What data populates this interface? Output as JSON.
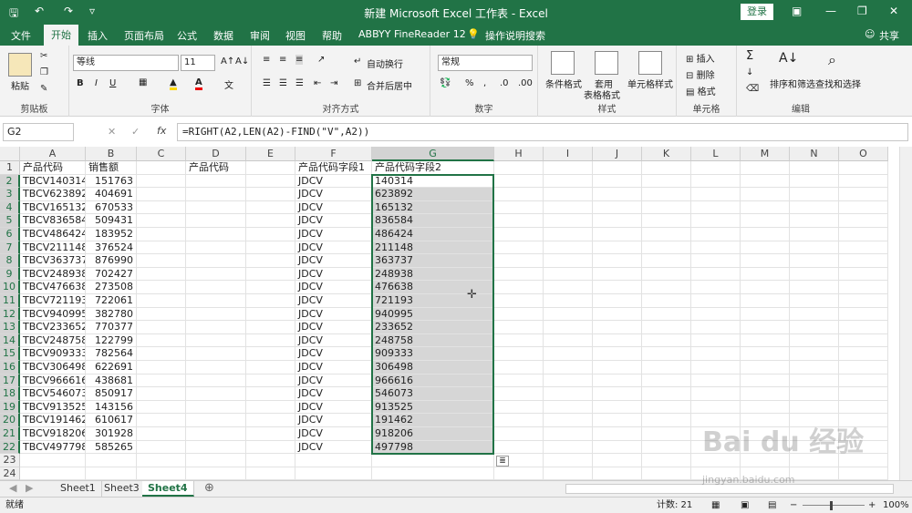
{
  "titlebar": {
    "title": "新建 Microsoft Excel 工作表 - Excel",
    "login": "登录"
  },
  "tabs": [
    "文件",
    "开始",
    "插入",
    "页面布局",
    "公式",
    "数据",
    "审阅",
    "视图",
    "帮助",
    "ABBYY FineReader 12",
    "操作说明搜索"
  ],
  "share": "共享",
  "ribbon": {
    "clipboard": {
      "label": "剪贴板",
      "paste": "粘贴"
    },
    "font": {
      "label": "字体",
      "name": "等线",
      "size": "11",
      "bold": "B",
      "italic": "I",
      "underline": "U"
    },
    "align": {
      "label": "对齐方式",
      "wrap": "自动换行",
      "merge": "合并后居中"
    },
    "number": {
      "label": "数字",
      "format": "常规"
    },
    "styles": {
      "label": "样式",
      "cond": "条件格式",
      "table1": "套用",
      "table2": "表格格式",
      "cell": "单元格样式"
    },
    "cells": {
      "label": "单元格",
      "insert": "插入",
      "delete": "删除",
      "format": "格式"
    },
    "editing": {
      "label": "编辑",
      "sort": "排序和筛选",
      "find": "查找和选择"
    }
  },
  "formula_bar": {
    "namebox": "G2",
    "fx": "fx",
    "formula": "=RIGHT(A2,LEN(A2)-FIND(\"V\",A2))"
  },
  "columns": [
    "A",
    "B",
    "C",
    "D",
    "E",
    "F",
    "G",
    "H",
    "I",
    "J",
    "K",
    "L",
    "M",
    "N",
    "O"
  ],
  "header_row": {
    "A": "产品代码",
    "B": "销售额",
    "D": "产品代码",
    "F": "产品代码字段1",
    "G": "产品代码字段2"
  },
  "rows": [
    {
      "A": "TBCV140314",
      "B": "151763",
      "F": "JDCV",
      "G": "140314"
    },
    {
      "A": "TBCV623892",
      "B": "404691",
      "F": "JDCV",
      "G": "623892"
    },
    {
      "A": "TBCV165132",
      "B": "670533",
      "F": "JDCV",
      "G": "165132"
    },
    {
      "A": "TBCV836584",
      "B": "509431",
      "F": "JDCV",
      "G": "836584"
    },
    {
      "A": "TBCV486424",
      "B": "183952",
      "F": "JDCV",
      "G": "486424"
    },
    {
      "A": "TBCV211148",
      "B": "376524",
      "F": "JDCV",
      "G": "211148"
    },
    {
      "A": "TBCV363737",
      "B": "876990",
      "F": "JDCV",
      "G": "363737"
    },
    {
      "A": "TBCV248938",
      "B": "702427",
      "F": "JDCV",
      "G": "248938"
    },
    {
      "A": "TBCV476638",
      "B": "273508",
      "F": "JDCV",
      "G": "476638"
    },
    {
      "A": "TBCV721193",
      "B": "722061",
      "F": "JDCV",
      "G": "721193"
    },
    {
      "A": "TBCV940995",
      "B": "382780",
      "F": "JDCV",
      "G": "940995"
    },
    {
      "A": "TBCV233652",
      "B": "770377",
      "F": "JDCV",
      "G": "233652"
    },
    {
      "A": "TBCV248758",
      "B": "122799",
      "F": "JDCV",
      "G": "248758"
    },
    {
      "A": "TBCV909333",
      "B": "782564",
      "F": "JDCV",
      "G": "909333"
    },
    {
      "A": "TBCV306498",
      "B": "622691",
      "F": "JDCV",
      "G": "306498"
    },
    {
      "A": "TBCV966616",
      "B": "438681",
      "F": "JDCV",
      "G": "966616"
    },
    {
      "A": "TBCV546073",
      "B": "850917",
      "F": "JDCV",
      "G": "546073"
    },
    {
      "A": "TBCV913525",
      "B": "143156",
      "F": "JDCV",
      "G": "913525"
    },
    {
      "A": "TBCV191462",
      "B": "610617",
      "F": "JDCV",
      "G": "191462"
    },
    {
      "A": "TBCV918206",
      "B": "301928",
      "F": "JDCV",
      "G": "918206"
    },
    {
      "A": "TBCV497798",
      "B": "585265",
      "F": "JDCV",
      "G": "497798"
    }
  ],
  "extra_rows": [
    "23",
    "24"
  ],
  "sheets": [
    "Sheet1",
    "Sheet3",
    "Sheet4"
  ],
  "active_sheet": "Sheet4",
  "status": {
    "left": "就绪",
    "count": "计数: 21",
    "zoom": "100%"
  },
  "watermark": {
    "main": "Bai du 经验",
    "sub": "jingyan.baidu.com"
  }
}
